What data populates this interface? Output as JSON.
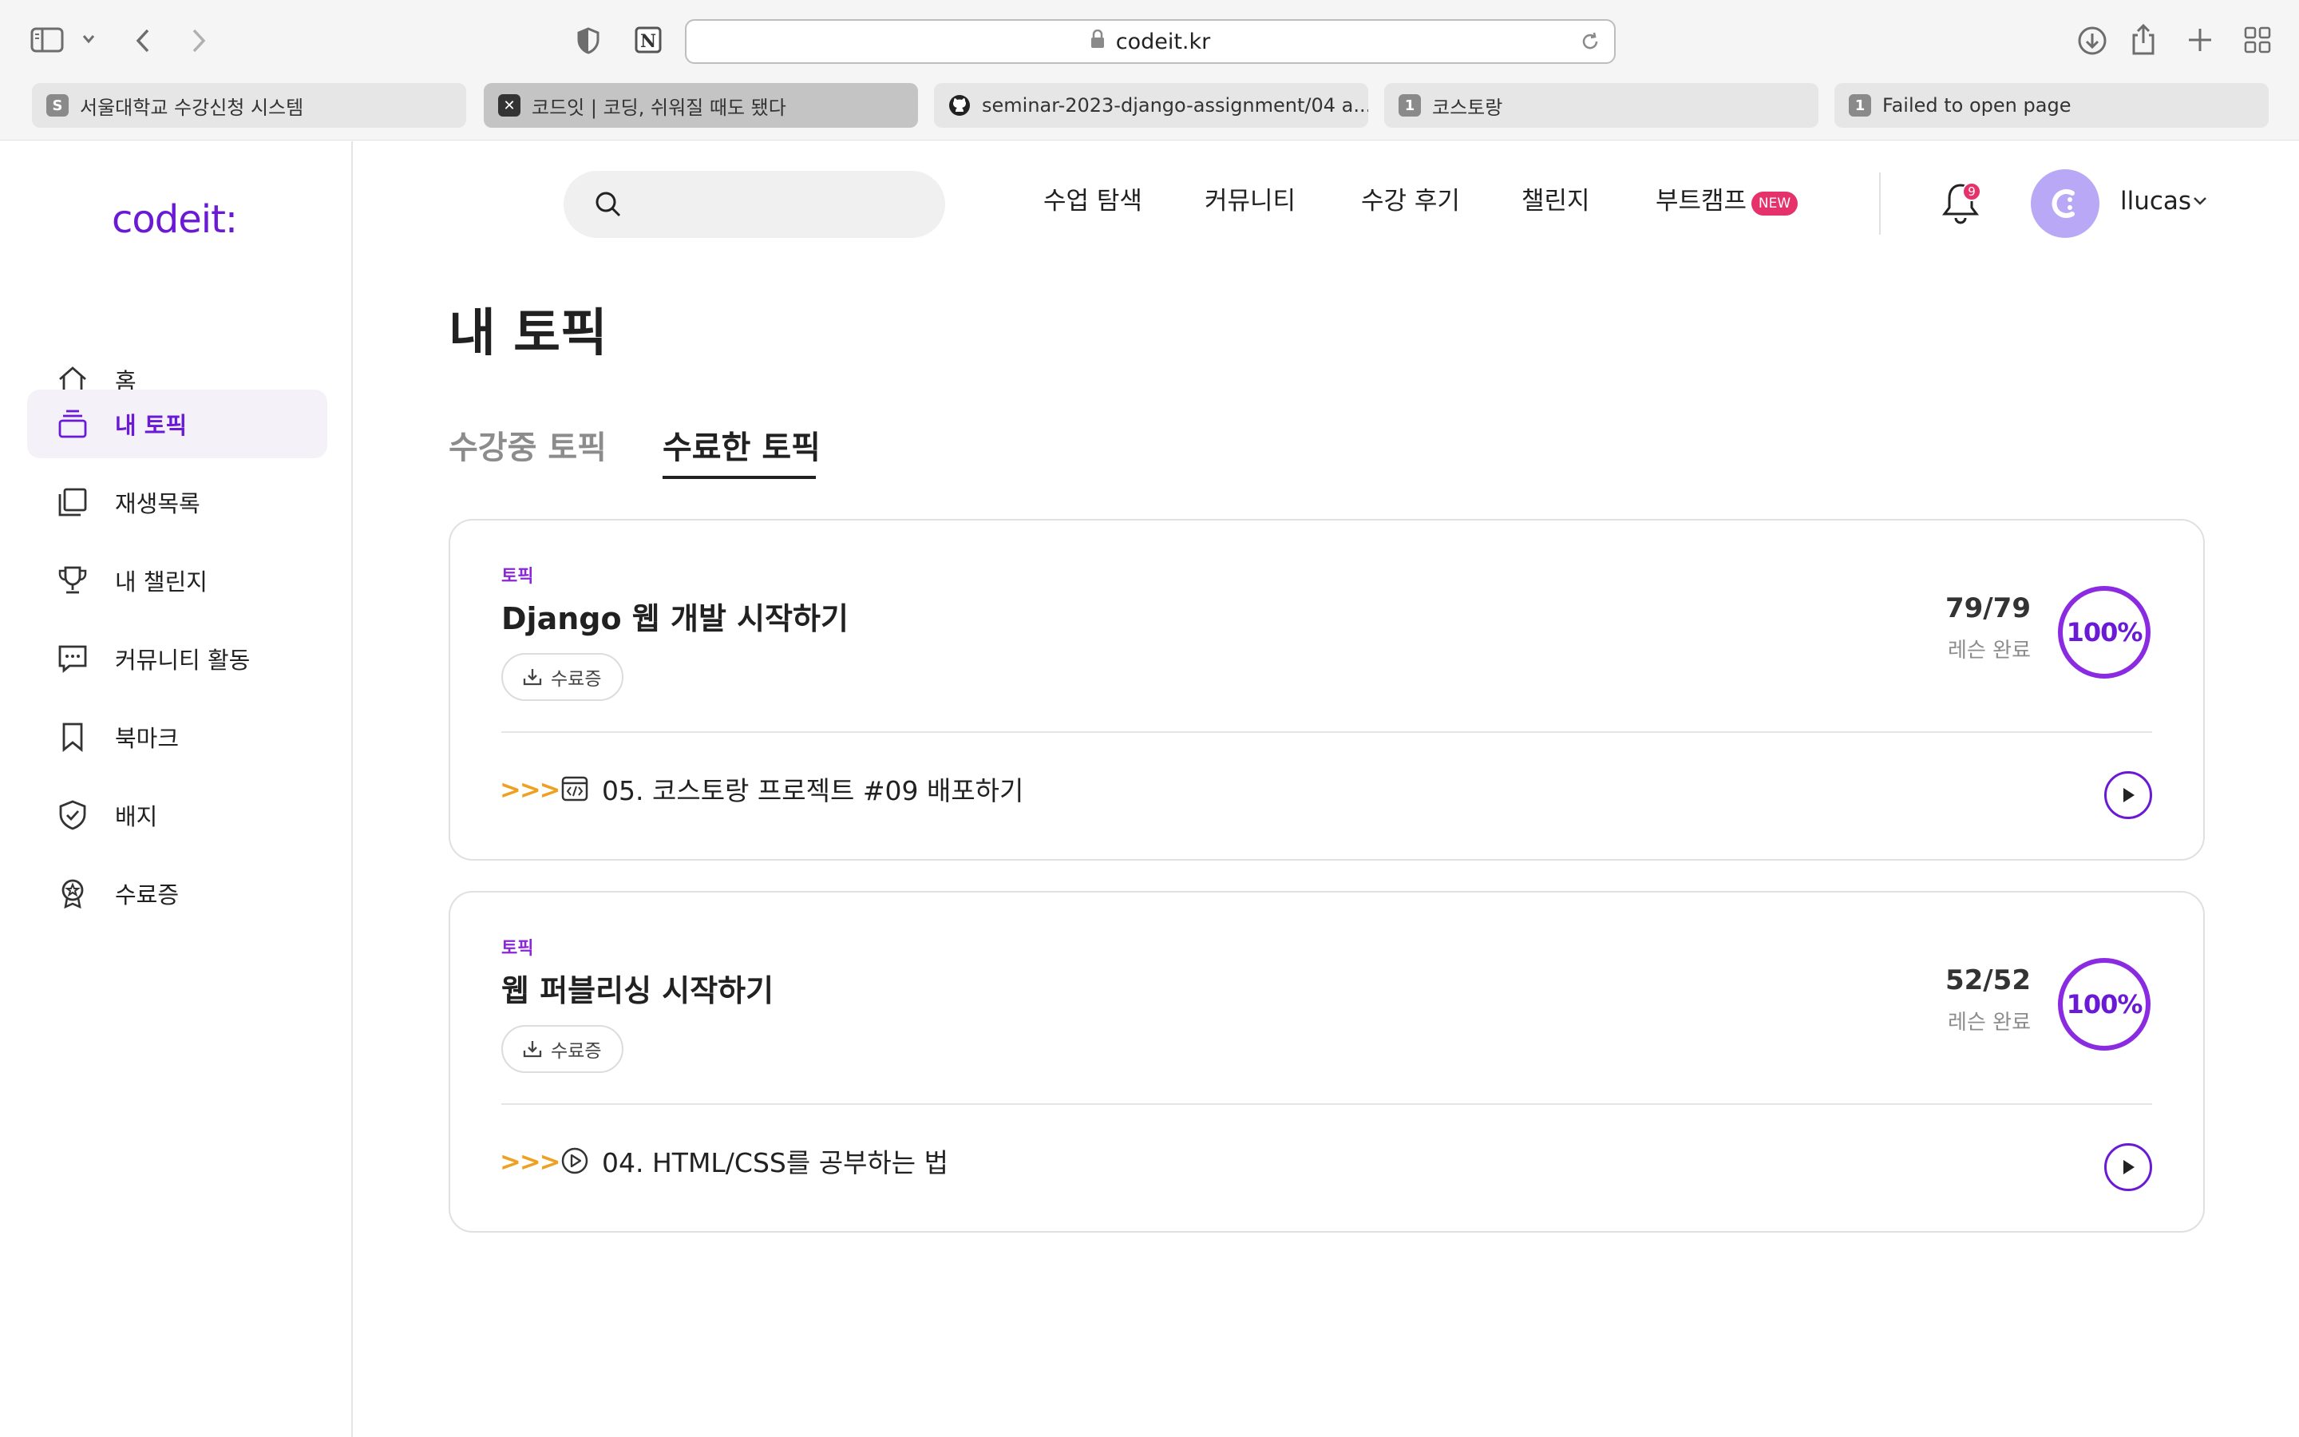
{
  "browser": {
    "url": "codeit.kr",
    "tabs": [
      {
        "title": "서울대학교 수강신청 시스템",
        "favicon": "S"
      },
      {
        "title": "코드잇 | 코딩, 쉬워질 때도 됐다",
        "favicon": "✕"
      },
      {
        "title": "seminar-2023-django-assignment/04 a...",
        "favicon": "github-icon"
      },
      {
        "title": "코스토랑",
        "favicon": "1"
      },
      {
        "title": "Failed to open page",
        "favicon": "1"
      }
    ]
  },
  "sidebar": {
    "logo": "codeit:",
    "items": [
      {
        "label": "홈",
        "icon": "home-icon"
      },
      {
        "label": "내 토픽",
        "icon": "topics-icon",
        "active": true
      },
      {
        "label": "재생목록",
        "icon": "playlist-icon"
      },
      {
        "label": "내 챌린지",
        "icon": "trophy-icon"
      },
      {
        "label": "커뮤니티 활동",
        "icon": "chat-icon"
      },
      {
        "label": "북마크",
        "icon": "bookmark-icon"
      },
      {
        "label": "배지",
        "icon": "badge-icon"
      },
      {
        "label": "수료증",
        "icon": "certificate-icon"
      }
    ]
  },
  "header": {
    "search_placeholder": "",
    "nav": [
      "수업 탐색",
      "커뮤니티",
      "수강 후기",
      "챌린지",
      "부트캠프"
    ],
    "new_badge": "NEW",
    "notification_count": "9",
    "username": "llucas"
  },
  "main": {
    "title": "내 토픽",
    "tabs": [
      {
        "label": "수강중 토픽",
        "selected": false
      },
      {
        "label": "수료한 토픽",
        "selected": true
      }
    ],
    "cards": [
      {
        "label": "토픽",
        "title": "Django 웹 개발 시작하기",
        "cert_button": "수료증",
        "count": "79/79",
        "count_sub": "레슨 완료",
        "percent_text": "100%",
        "progress": 1.0,
        "arrows": ">>>",
        "lesson_icon": "code-file-icon",
        "lesson": "05. 코스토랑 프로젝트 #09 배포하기"
      },
      {
        "label": "토픽",
        "title": "웹 퍼블리싱 시작하기",
        "cert_button": "수료증",
        "count": "52/52",
        "count_sub": "레슨 완료",
        "percent_text": "100%",
        "progress": 1.0,
        "arrows": ">>>",
        "lesson_icon": "video-play-icon",
        "lesson": "04. HTML/CSS를 공부하는 법"
      }
    ]
  },
  "colors": {
    "accent": "#6a19d4",
    "new_badge": "#e5326b",
    "arrows": "#f0a020",
    "active_nav_bg": "#f4f2f8"
  }
}
